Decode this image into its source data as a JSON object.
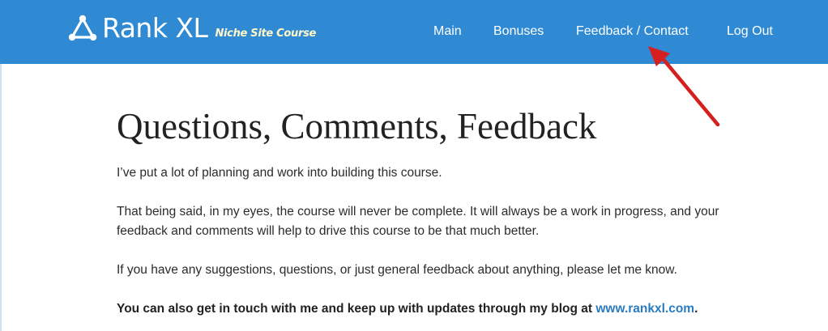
{
  "header": {
    "logo_name": "Rank XL",
    "logo_tagline": "Niche Site Course",
    "bg_color": "#2f8ad3"
  },
  "nav": {
    "items": [
      {
        "label": "Main"
      },
      {
        "label": "Bonuses"
      },
      {
        "label": "Feedback / Contact"
      },
      {
        "label": "Log Out"
      }
    ]
  },
  "main": {
    "title": "Questions, Comments, Feedback",
    "paragraphs": [
      "I’ve put a lot of planning and work into building this course.",
      "That being said, in my eyes, the course will never be complete. It will always be a work in progress, and your feedback and comments will help to drive this course to be that much better.",
      "If you have any suggestions, questions, or just general feedback about anything, please let me know."
    ],
    "contact_text": "You can also get in touch with me and keep up with updates through my blog at ",
    "contact_link": "www.rankxl.com",
    "contact_end": "."
  },
  "annotation": {
    "arrow_color": "#d62020",
    "icon": "red-arrow-icon"
  }
}
